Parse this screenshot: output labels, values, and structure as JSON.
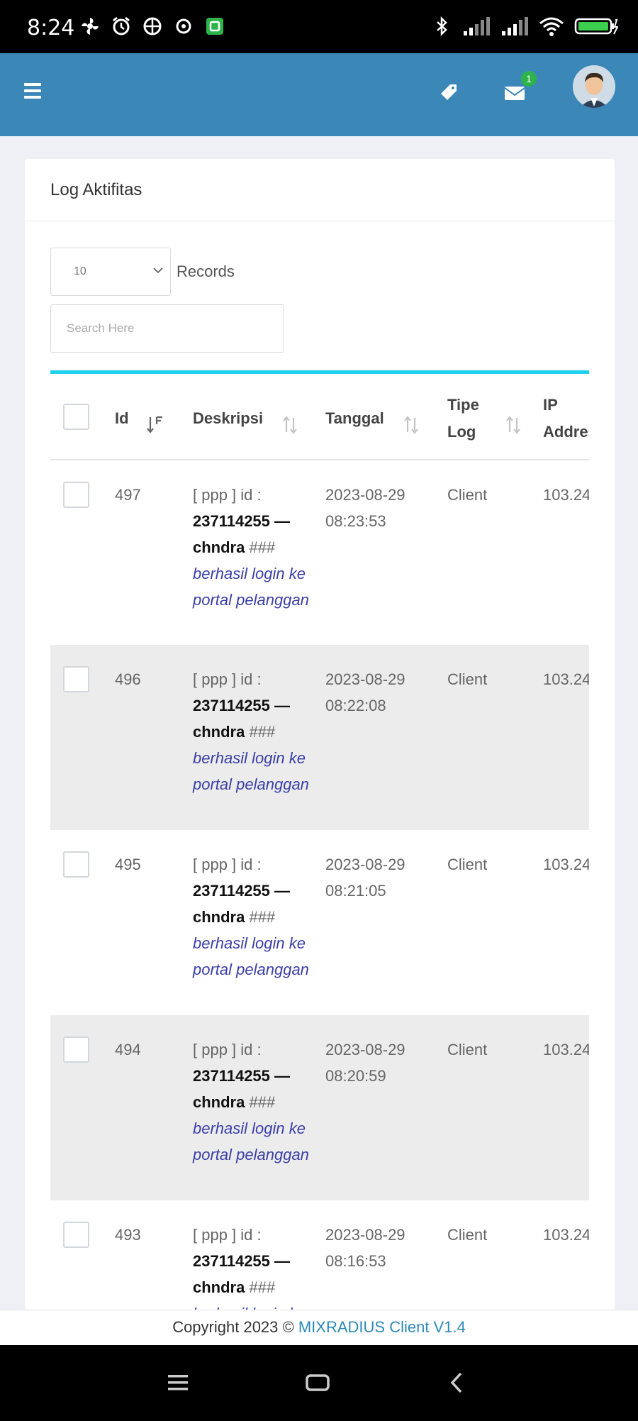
{
  "status_bar": {
    "time": "8:24",
    "icons_left": [
      "fan-icon",
      "alarm-icon",
      "vpn-icon",
      "sync-icon",
      "app-icon"
    ],
    "icons_right": [
      "bluetooth-icon",
      "signal-icon",
      "signal-icon",
      "wifi-icon",
      "battery-icon"
    ]
  },
  "header": {
    "mail_badge": "1",
    "icons": [
      "menu-icon",
      "tag-icon",
      "mail-icon",
      "avatar"
    ]
  },
  "card": {
    "title": "Log Aktifitas",
    "records_value": "10",
    "records_label": "Records",
    "search_placeholder": "Search Here"
  },
  "table": {
    "columns": {
      "id": "Id",
      "deskripsi": "Deskripsi",
      "tanggal": "Tanggal",
      "tipe_log": "Tipe Log",
      "ip": "IP Address"
    },
    "rows": [
      {
        "id": "497",
        "desc_pre": "[ ppp ] id :",
        "desc_bold": "237114255 — chndra",
        "desc_hash": "###",
        "desc_ital": "berhasil login ke portal pelanggan",
        "tanggal": "2023-08-29 08:23:53",
        "tipe": "Client",
        "ip": "103.24"
      },
      {
        "id": "496",
        "desc_pre": "[ ppp ] id :",
        "desc_bold": "237114255 — chndra",
        "desc_hash": "###",
        "desc_ital": "berhasil login ke portal pelanggan",
        "tanggal": "2023-08-29 08:22:08",
        "tipe": "Client",
        "ip": "103.24"
      },
      {
        "id": "495",
        "desc_pre": "[ ppp ] id :",
        "desc_bold": "237114255 — chndra",
        "desc_hash": "###",
        "desc_ital": "berhasil login ke portal pelanggan",
        "tanggal": "2023-08-29 08:21:05",
        "tipe": "Client",
        "ip": "103.24"
      },
      {
        "id": "494",
        "desc_pre": "[ ppp ] id :",
        "desc_bold": "237114255 — chndra",
        "desc_hash": "###",
        "desc_ital": "berhasil login ke portal pelanggan",
        "tanggal": "2023-08-29 08:20:59",
        "tipe": "Client",
        "ip": "103.24"
      },
      {
        "id": "493",
        "desc_pre": "[ ppp ] id :",
        "desc_bold": "237114255 — chndra",
        "desc_hash": "###",
        "desc_ital": "berhasil login ke portal pelanggan",
        "tanggal": "2023-08-29 08:16:53",
        "tipe": "Client",
        "ip": "103.24"
      }
    ]
  },
  "footer": {
    "copyright": "Copyright 2023 ©",
    "brand": "MIXRADIUS Client V1.4"
  },
  "colors": {
    "header_bg": "#3b87b7",
    "accent_rule": "#1fd1ec",
    "badge": "#2db34a",
    "link_italic": "#3a3fa8",
    "brand_link": "#2c8ab8"
  }
}
